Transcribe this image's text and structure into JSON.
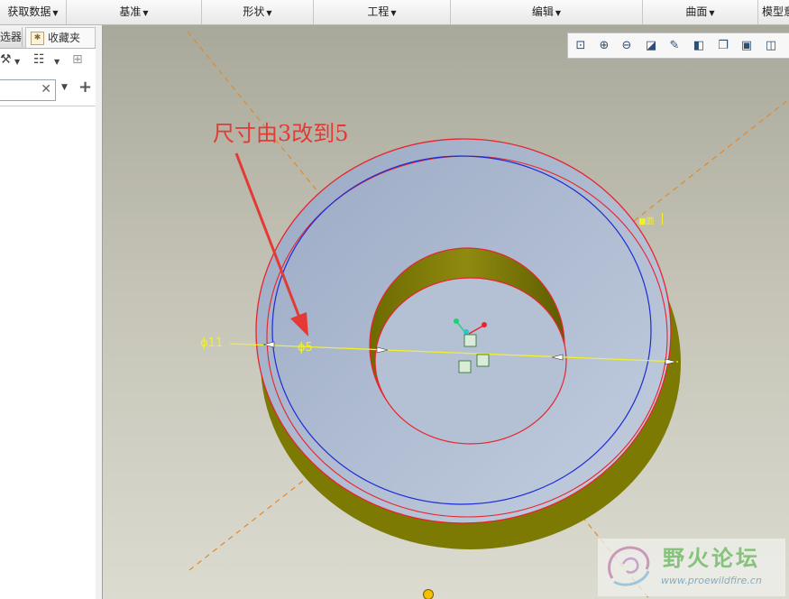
{
  "menubar": {
    "items": [
      {
        "label": "获取数据"
      },
      {
        "label": "基准"
      },
      {
        "label": "形状"
      },
      {
        "label": "工程"
      },
      {
        "label": "编辑"
      },
      {
        "label": "曲面"
      },
      {
        "label": "模型意"
      }
    ]
  },
  "left_panel": {
    "tabs": [
      {
        "label": "选器"
      },
      {
        "label": "收藏夹"
      }
    ],
    "search": {
      "value": ""
    }
  },
  "annotation": {
    "text": "尺寸由3改到5",
    "color": "#e53935"
  },
  "dimensions": {
    "outer": "ϕ11",
    "inner": "ϕ5",
    "plane_label": "■面"
  },
  "watermark": {
    "title": "野火论坛",
    "url": "www.proewildfire.cn"
  },
  "colors": {
    "face": "#aebbd0",
    "side": "#7d7a04",
    "edge_highlight": "#e8242c",
    "sketch_circle": "#1e2bd6",
    "dimension_line": "#f2ef2c",
    "axis_dash": "#e08a2a"
  }
}
